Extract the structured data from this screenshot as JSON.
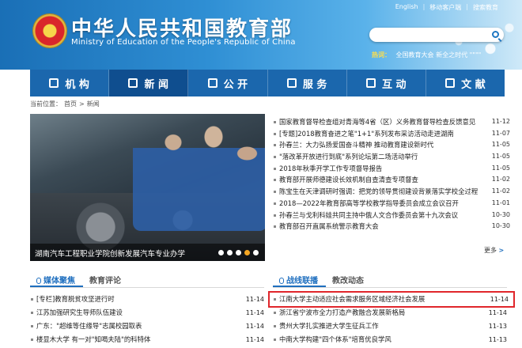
{
  "header": {
    "title_zh": "中华人民共和国教育部",
    "title_en": "Ministry of Education of the People's Republic of China",
    "emblem_text": "国徽",
    "toplinks": [
      "English",
      "移动客户端",
      "搜索教育"
    ],
    "search": {
      "placeholder": ""
    },
    "hot": {
      "label": "热词：",
      "words": "全国教育大会  新全之时代 \"\"\"\""
    }
  },
  "nav": [
    {
      "label": "机 构",
      "icon": "building-icon"
    },
    {
      "label": "新 闻",
      "icon": "news-icon",
      "active": true
    },
    {
      "label": "公 开",
      "icon": "lock-icon"
    },
    {
      "label": "服 务",
      "icon": "service-icon"
    },
    {
      "label": "互 动",
      "icon": "chat-icon"
    },
    {
      "label": "文 献",
      "icon": "book-icon"
    }
  ],
  "breadcrumb": {
    "label": "当前位置：",
    "home": "首页",
    "sep": ">",
    "current": "新闻"
  },
  "hero": {
    "caption": "湖南汽车工程职业学院创新发展汽车专业办学",
    "dots": 5,
    "active_dot": 4
  },
  "news": [
    {
      "title": "国家教育督导检查组对青海等4省（区）义务教育督导检查反馈意见",
      "date": "11-12"
    },
    {
      "title": "[专题]2018教育奋进之笔\"1+1\"系列发布采访活动走进湖南",
      "date": "11-07"
    },
    {
      "title": "孙春兰：大力弘扬爱国奋斗精神 推动教育建设新时代",
      "date": "11-05"
    },
    {
      "title": "\"落改革开放进行到底\"系列论坛第二场活动举行",
      "date": "11-05"
    },
    {
      "title": "2018年秋季开学工作专项督导报告",
      "date": "11-05"
    },
    {
      "title": "教育部开展师德建设长效机制自查清查专项督查",
      "date": "11-02"
    },
    {
      "title": "陈宝生在天津调研时强调：把党的领导贯彻建设背景落实学校全过程",
      "date": "11-02"
    },
    {
      "title": "2018—2022年教育部高等学校教学指导委员会成立会议召开",
      "date": "11-01"
    },
    {
      "title": "孙春兰与戈利科娃共同主持中俄人文合作委员会第十九次会议",
      "date": "10-30"
    },
    {
      "title": "教育部召开直属系统警示教育大会",
      "date": "10-30"
    }
  ],
  "more": {
    "label": "更多",
    "arrow": ">"
  },
  "left_panel": {
    "tabs": [
      "媒体聚焦",
      "教育评论"
    ],
    "rows": [
      {
        "title": "[专栏]教育脱贫攻坚进行时",
        "date": "11-14"
      },
      {
        "title": "江苏加强研究生导师队伍建设",
        "date": "11-14"
      },
      {
        "title": "广东：\"超维等住缘导\"志属校园取表",
        "date": "11-14"
      },
      {
        "title": "楼显木大学 有一对\"知喝夫陆\"的科特体",
        "date": "11-14"
      }
    ]
  },
  "right_panel": {
    "tabs": [
      "战线联播",
      "教改动态"
    ],
    "rows": [
      {
        "title": "江南大学主动适应社会需求服务区域经济社会发展",
        "date": "11-14",
        "highlight": true
      },
      {
        "title": "浙江省宁波市全力打造产教融合发展新格局",
        "date": "11-14"
      },
      {
        "title": "贵州大学扎实推进大学生征兵工作",
        "date": "11-13"
      },
      {
        "title": "中南大学构建\"四个体系\"培育优良学风",
        "date": "11-13"
      }
    ]
  },
  "colors": {
    "nav": "#1b67ad",
    "nav_active": "#0f4e8f",
    "accent": "#1f6fbf",
    "highlight": "#e0262b"
  }
}
